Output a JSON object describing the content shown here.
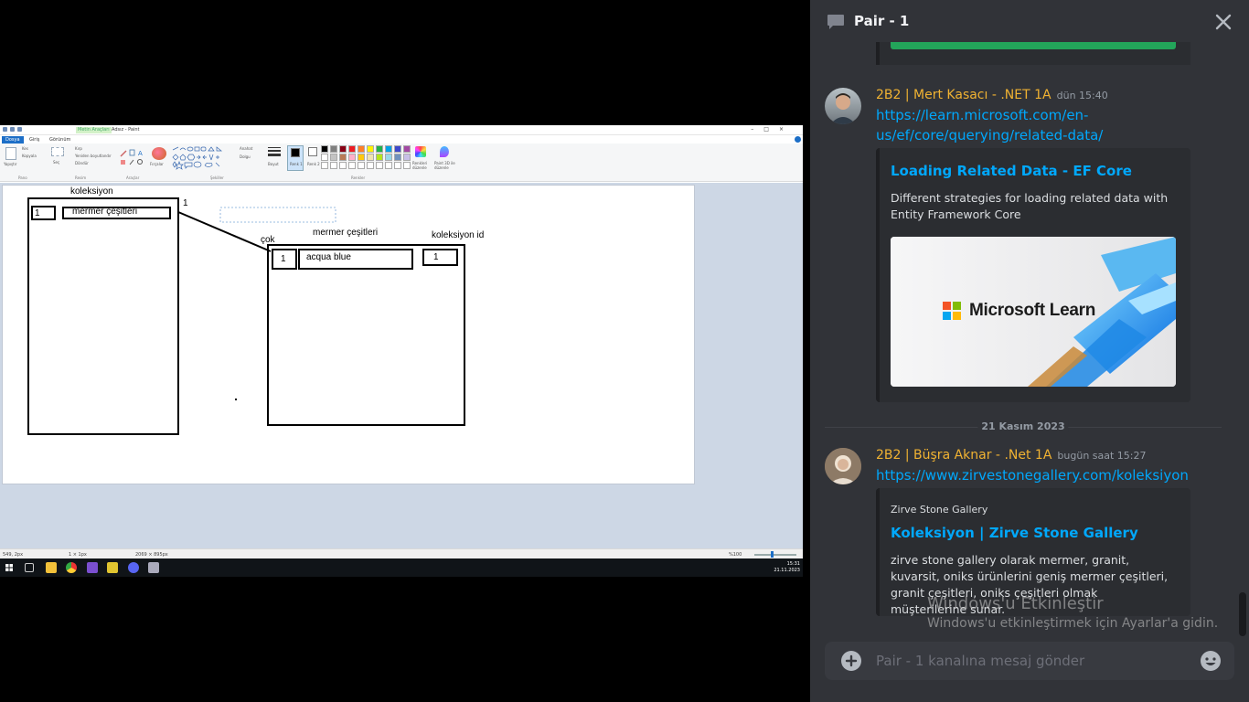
{
  "paint": {
    "context_tab": "Metin Araçları",
    "title": "Adsız - Paint",
    "tabs": [
      "Dosya",
      "Giriş",
      "Görünüm"
    ],
    "ribbon": {
      "paste": "Yapıştır",
      "cut": "Kes",
      "copy": "Kopyala",
      "select": "Seç",
      "crop": "Kırp",
      "resize": "Yeniden boyutlandır",
      "rotate": "Döndür",
      "brushes": "Fırçalar",
      "outline": "Anahat",
      "fill": "Dolgu",
      "size": "Boyut",
      "color1": "Renk 1",
      "color2": "Renk 2",
      "edit_colors": "Renkleri düzenle",
      "paint3d": "Paint 3D ile düzenle",
      "groups": [
        "Pano",
        "Resim",
        "Araçlar",
        "Şekiller",
        "Renkler"
      ]
    },
    "canvas": {
      "label_koleksiyon": "koleksiyon",
      "label_one": "1",
      "cell_1_left": "1",
      "cell_mermer": "mermer çeşitleri",
      "label_cok": "çok",
      "label_mermer_cesitleri": "mermer çeşitleri",
      "label_koleksiyon_id": "koleksiyon id",
      "cell_1_right": "1",
      "cell_acqua": "acqua blue",
      "cell_id_val": "1"
    },
    "status": {
      "cursor_pos": "549, 2px",
      "selection": "1 × 1px",
      "image_size": "2069 × 895px",
      "zoom": "%100"
    },
    "clock": {
      "time": "15:31",
      "date": "21.11.2023"
    }
  },
  "discord": {
    "thread_title": "Pair - 1",
    "messages": [
      {
        "author": "2B2 | Mert Kasacı - .NET 1A",
        "time": "dün 15:40",
        "link": "https://learn.microsoft.com/en-us/ef/core/querying/related-data/",
        "link_line1": "https://learn.microsoft.com/en-",
        "link_line2": "us/ef/core/querying/related-data/",
        "embed": {
          "title": "Loading Related Data - EF Core",
          "description": "Different strategies for loading related data with Entity Framework Core",
          "image_text": "Microsoft Learn"
        }
      },
      {
        "author": "2B2 | Büşra Aknar - .Net 1A",
        "time": "bugün saat 15:27",
        "link": "https://www.zirvestonegallery.com/koleksiyon",
        "embed": {
          "provider": "Zirve Stone Gallery",
          "title": "Koleksiyon | Zirve Stone Gallery",
          "description": "zirve stone gallery olarak mermer, granit, kuvarsit, oniks ürünlerini geniş mermer çeşitleri, granit çeşitleri, oniks çeşitleri olmak müşterilerine sunar."
        }
      }
    ],
    "date_divider": "21 Kasım 2023",
    "composer_placeholder": "Pair - 1 kanalına mesaj gönder",
    "watermark_line1": "Windows'u Etkinleştir",
    "watermark_line2": "Windows'u etkinleştirmek için Ayarlar'a gidin.",
    "colors": {
      "accent_link": "#00a8fc",
      "author": "#f0b232",
      "bg": "#313338",
      "embed_bg": "#2b2d31"
    }
  }
}
